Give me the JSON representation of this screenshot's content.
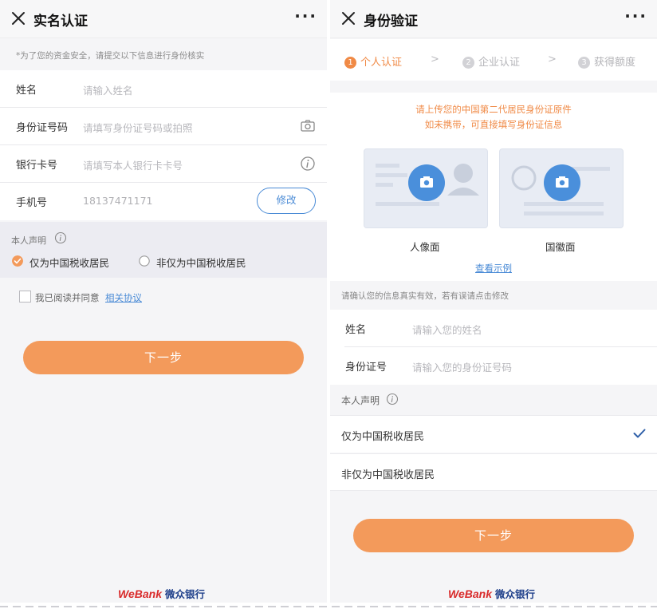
{
  "colors": {
    "accent": "#f39a5b",
    "link": "#4a8bd6",
    "brand_red": "#d92b2b",
    "brand_blue": "#1e3f8a",
    "camera_blue": "#4a8fdb"
  },
  "left": {
    "title": "实名认证",
    "more": "···",
    "notice": "*为了您的资金安全，请提交以下信息进行身份核实",
    "fields": [
      {
        "label": "姓名",
        "placeholder": "请输入姓名"
      },
      {
        "label": "身份证号码",
        "placeholder": "请填写身份证号码或拍照",
        "icon": "camera-icon"
      },
      {
        "label": "银行卡号",
        "placeholder": "请填写本人银行卡卡号",
        "icon": "info-icon"
      },
      {
        "label": "手机号",
        "value": "18137471171",
        "action": "修改"
      }
    ],
    "declaration": {
      "heading": "本人声明",
      "options": [
        {
          "label": "仅为中国税收居民",
          "selected": true
        },
        {
          "label": "非仅为中国税收居民",
          "selected": false
        }
      ]
    },
    "agreement": {
      "text": "我已阅读并同意",
      "link": "相关协议"
    },
    "next": "下一步",
    "footer": {
      "brand": "WeBank",
      "name": "微众银行"
    }
  },
  "right": {
    "title": "身份验证",
    "more": "···",
    "steps": [
      {
        "num": "1",
        "label": "个人认证",
        "active": true
      },
      {
        "num": "2",
        "label": "企业认证",
        "active": false
      },
      {
        "num": "3",
        "label": "获得额度",
        "active": false
      }
    ],
    "step_sep": ">",
    "upload": {
      "hint_line1": "请上传您的中国第二代居民身份证原件",
      "hint_line2": "如未携带，可直接填写身份证信息",
      "front_label": "人像面",
      "back_label": "国徽面",
      "example_link": "查看示例"
    },
    "confirm": "请确认您的信息真实有效，若有误请点击修改",
    "fields": [
      {
        "label": "姓名",
        "placeholder": "请输入您的姓名"
      },
      {
        "label": "身份证号",
        "placeholder": "请输入您的身份证号码"
      }
    ],
    "declaration": {
      "heading": "本人声明",
      "options": [
        {
          "label": "仅为中国税收居民",
          "selected": true
        },
        {
          "label": "非仅为中国税收居民",
          "selected": false
        }
      ]
    },
    "next": "下一步",
    "footer": {
      "brand": "WeBank",
      "name": "微众银行"
    }
  }
}
